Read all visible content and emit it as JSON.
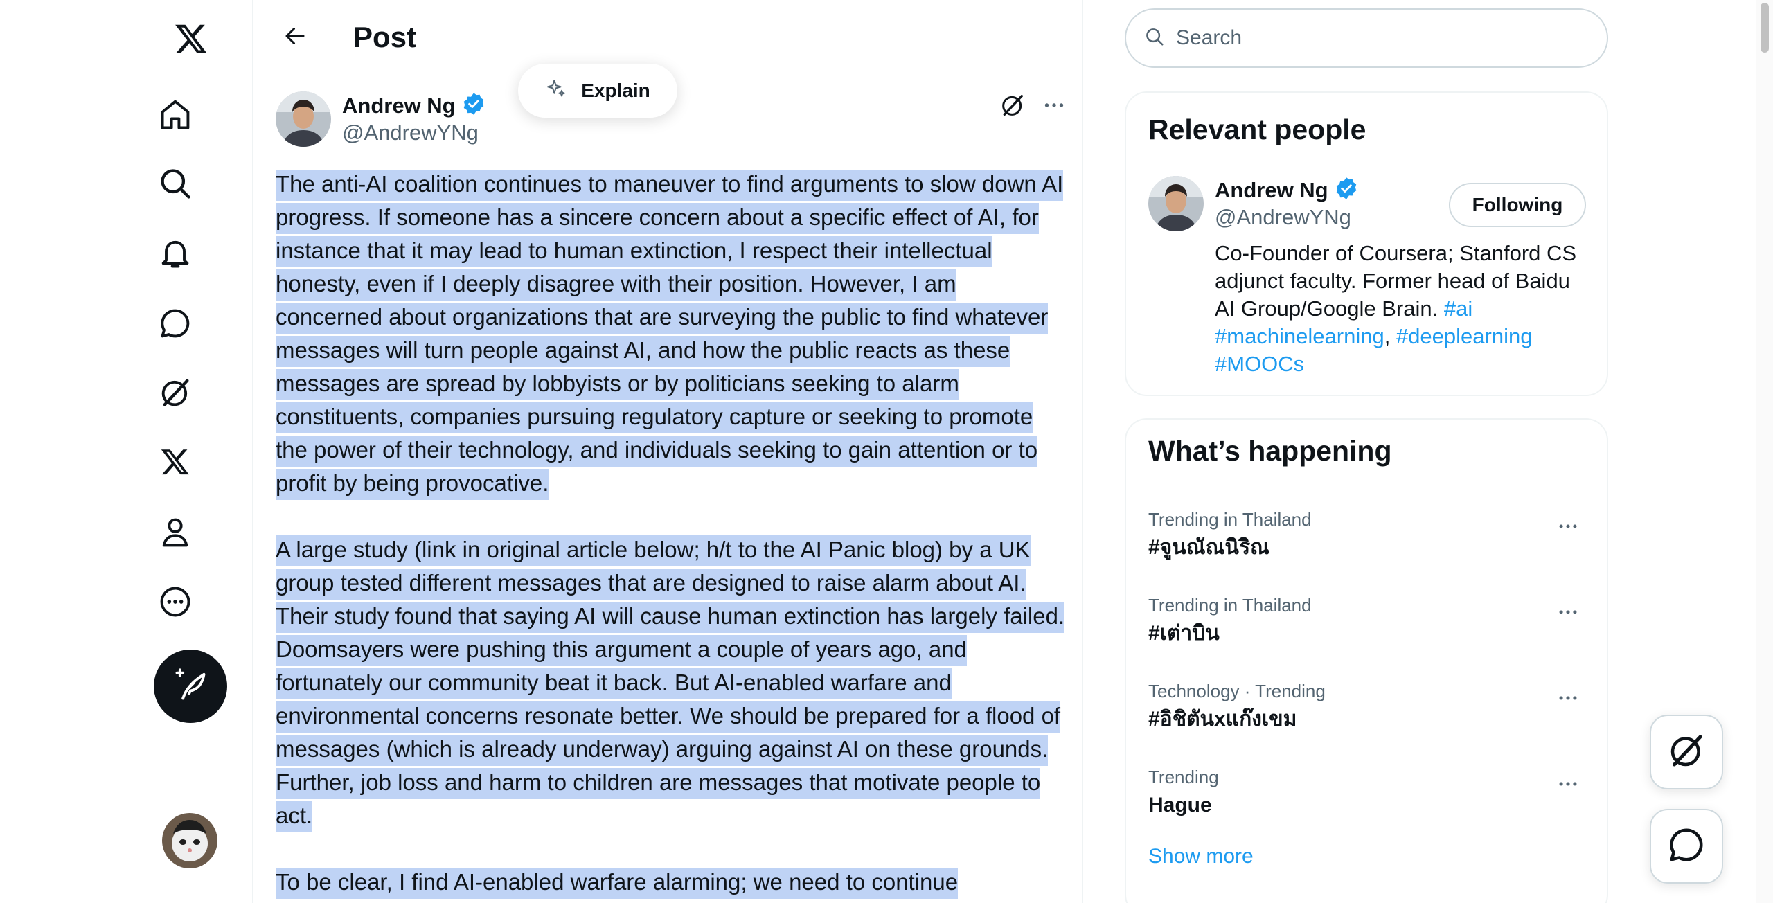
{
  "nav": {
    "items": [
      {
        "name": "home",
        "icon": "home-icon"
      },
      {
        "name": "explore",
        "icon": "search-icon"
      },
      {
        "name": "notifications",
        "icon": "bell-icon"
      },
      {
        "name": "messages",
        "icon": "chat-bubble-icon"
      },
      {
        "name": "grok",
        "icon": "grok-icon"
      },
      {
        "name": "premium",
        "icon": "x-logo-icon"
      },
      {
        "name": "profile",
        "icon": "person-icon"
      },
      {
        "name": "more",
        "icon": "more-circle-icon"
      }
    ],
    "compose_icon": "feather-plus-icon"
  },
  "header": {
    "title": "Post"
  },
  "explain": {
    "label": "Explain"
  },
  "post": {
    "author_name": "Andrew Ng",
    "author_handle": "@AndrewYNg",
    "paragraphs": [
      "The anti-AI coalition continues to maneuver to find arguments to slow down AI progress. If someone has a sincere concern about a specific effect of AI, for instance that it may lead to human extinction, I respect their intellectual honesty, even if I deeply disagree with their position. However, I am concerned about organizations that are surveying the public to find whatever messages will turn people against AI, and how the public reacts as these messages are spread by lobbyists or by politicians seeking to alarm constituents, companies pursuing regulatory capture or seeking to promote the power of their technology, and individuals seeking to gain attention or to profit by being provocative.",
      "A large study (link in original article below; h/t to the AI Panic blog) by a UK group tested different messages that are designed to raise alarm about AI. Their study found that saying AI will cause human extinction has largely failed. Doomsayers were pushing this argument a couple of years ago, and fortunately our community beat it back. But AI-enabled warfare and environmental concerns resonate better. We should be prepared for a flood of messages (which is already underway) arguing against AI on these grounds. Further, job loss and harm to children are messages that motivate people to act.",
      "To be clear, I find AI-enabled warfare alarming; we need to continue"
    ]
  },
  "search": {
    "placeholder": "Search"
  },
  "relevant_people": {
    "title": "Relevant people",
    "name": "Andrew Ng",
    "handle": "@AndrewYNg",
    "follow_label": "Following",
    "bio_text": "Co-Founder of Coursera; Stanford CS adjunct faculty. Former head of Baidu AI Group/Google Brain. ",
    "bio_tags": [
      "#ai",
      "#machinelearning",
      "#deeplearning",
      "#MOOCs"
    ]
  },
  "trending": {
    "title": "What’s happening",
    "items": [
      {
        "category": "Trending in Thailand",
        "name": "#จูนณัณนิริณ"
      },
      {
        "category": "Trending in Thailand",
        "name": "#เต่าบิน"
      },
      {
        "category": "Technology · Trending",
        "name": "#อิชิตันxแก๊งเขม"
      },
      {
        "category": "Trending",
        "name": "Hague"
      }
    ],
    "show_more": "Show more"
  },
  "colors": {
    "accent": "#1d9bf0",
    "selection": "#bfd3f5",
    "text": "#0f1419",
    "muted": "#536471"
  }
}
